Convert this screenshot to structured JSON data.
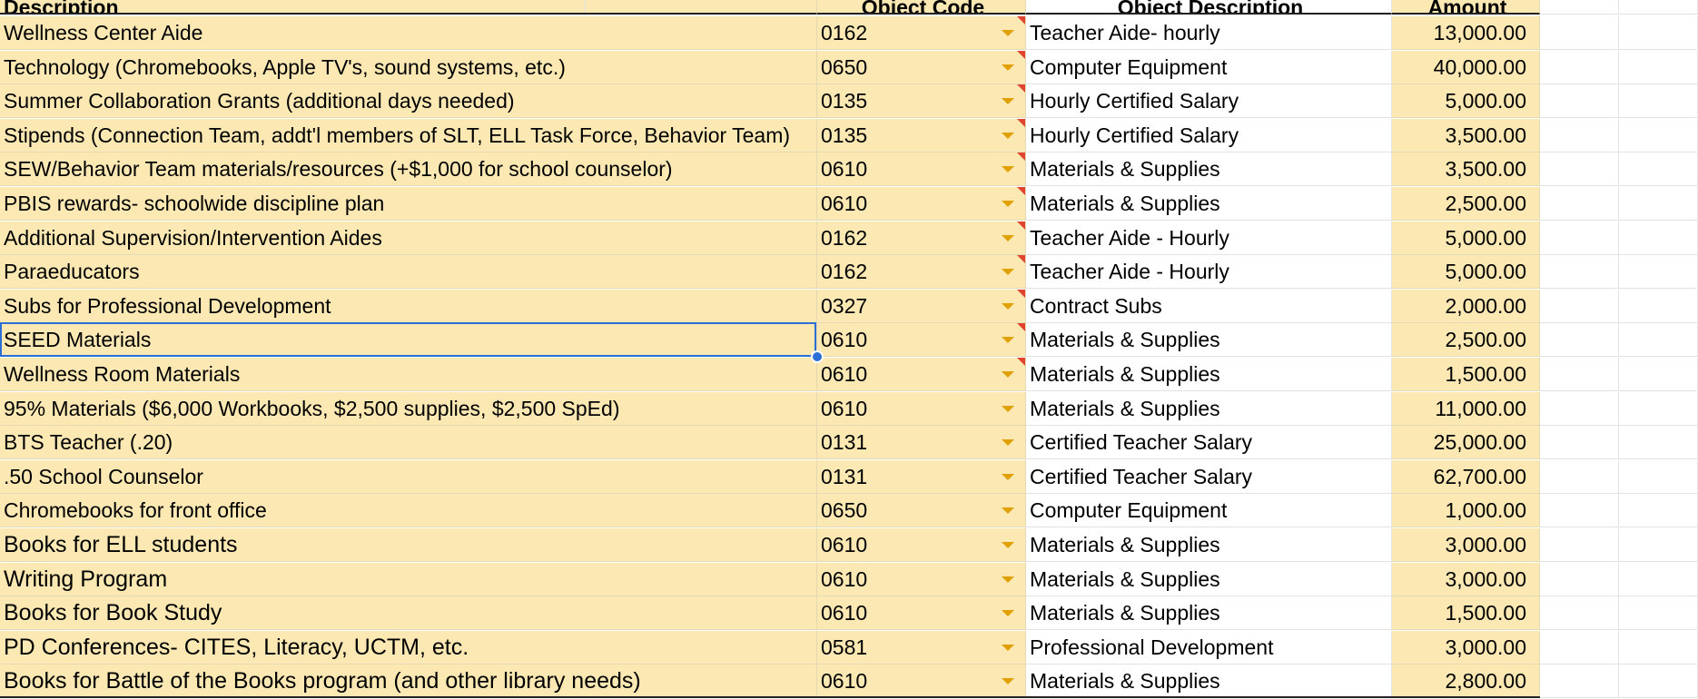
{
  "header": {
    "description": "Description",
    "object_code": "Object Code",
    "object_description": "Object Description",
    "amount": "Amount"
  },
  "rows": [
    {
      "description": "Wellness Center Aide",
      "code": "0162",
      "object_description": "Teacher Aide- hourly",
      "amount": "13,000.00",
      "note": true,
      "big": false
    },
    {
      "description": "Technology (Chromebooks, Apple TV's, sound systems, etc.)",
      "code": "0650",
      "object_description": "Computer Equipment",
      "amount": "40,000.00",
      "note": true,
      "big": false
    },
    {
      "description": "Summer Collaboration Grants (additional days needed)",
      "code": "0135",
      "object_description": "Hourly Certified Salary",
      "amount": "5,000.00",
      "note": true,
      "big": false
    },
    {
      "description": "Stipends (Connection Team, addt'l members of SLT, ELL Task Force, Behavior Team)",
      "code": "0135",
      "object_description": "Hourly Certified Salary",
      "amount": "3,500.00",
      "note": true,
      "big": false
    },
    {
      "description": "SEW/Behavior Team materials/resources (+$1,000 for school counselor)",
      "code": "0610",
      "object_description": "Materials & Supplies",
      "amount": "3,500.00",
      "note": true,
      "big": false
    },
    {
      "description": "PBIS rewards- schoolwide discipline plan",
      "code": "0610",
      "object_description": "Materials & Supplies",
      "amount": "2,500.00",
      "note": true,
      "big": false
    },
    {
      "description": "Additional Supervision/Intervention Aides",
      "code": "0162",
      "object_description": "Teacher Aide - Hourly",
      "amount": "5,000.00",
      "note": true,
      "big": false
    },
    {
      "description": "Paraeducators",
      "code": "0162",
      "object_description": "Teacher Aide - Hourly",
      "amount": "5,000.00",
      "note": true,
      "big": false
    },
    {
      "description": "Subs for Professional Development",
      "code": "0327",
      "object_description": "Contract Subs",
      "amount": "2,000.00",
      "note": true,
      "big": false
    },
    {
      "description": "SEED Materials",
      "code": "0610",
      "object_description": "Materials & Supplies",
      "amount": "2,500.00",
      "note": true,
      "big": false
    },
    {
      "description": "Wellness Room Materials",
      "code": "0610",
      "object_description": "Materials & Supplies",
      "amount": "1,500.00",
      "note": true,
      "big": false
    },
    {
      "description": "95% Materials ($6,000 Workbooks, $2,500 supplies, $2,500 SpEd)",
      "code": "0610",
      "object_description": "Materials & Supplies",
      "amount": "11,000.00",
      "note": false,
      "big": false
    },
    {
      "description": "BTS Teacher (.20)",
      "code": "0131",
      "object_description": "Certified Teacher Salary",
      "amount": "25,000.00",
      "note": false,
      "big": false
    },
    {
      "description": ".50 School Counselor",
      "code": "0131",
      "object_description": "Certified Teacher Salary",
      "amount": "62,700.00",
      "note": false,
      "big": false
    },
    {
      "description": "Chromebooks for front office",
      "code": "0650",
      "object_description": "Computer Equipment",
      "amount": "1,000.00",
      "note": false,
      "big": false
    },
    {
      "description": "Books for ELL students",
      "code": "0610",
      "object_description": "Materials & Supplies",
      "amount": "3,000.00",
      "note": false,
      "big": true
    },
    {
      "description": "Writing Program",
      "code": "0610",
      "object_description": "Materials & Supplies",
      "amount": "3,000.00",
      "note": false,
      "big": true
    },
    {
      "description": "Books for Book Study",
      "code": "0610",
      "object_description": "Materials & Supplies",
      "amount": "1,500.00",
      "note": false,
      "big": true
    },
    {
      "description": "PD Conferences- CITES, Literacy, UCTM, etc.",
      "code": "0581",
      "object_description": "Professional Development",
      "amount": "3,000.00",
      "note": false,
      "big": true
    },
    {
      "description": "Books for Battle of the Books program (and other library needs)",
      "code": "0610",
      "object_description": "Materials & Supplies",
      "amount": "2,800.00",
      "note": false,
      "big": true
    }
  ],
  "selected_row": 9,
  "colors": {
    "highlight": "#fce8b2",
    "selection": "#2b6fd6",
    "dropdown_arrow": "#e0a100",
    "note_marker": "#e0432e"
  }
}
